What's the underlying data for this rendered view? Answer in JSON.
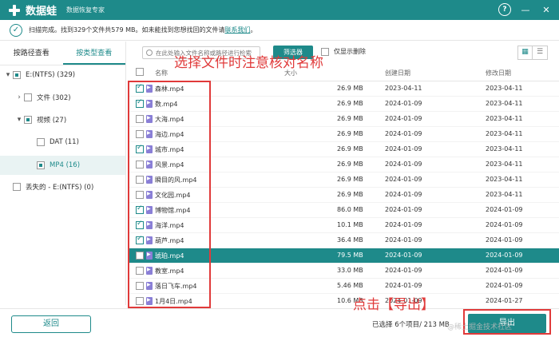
{
  "titlebar": {
    "app_name": "数据蛙",
    "subtitle": "数据恢复专家",
    "help": "?",
    "minimize": "—",
    "close": "✕"
  },
  "status": {
    "text": "扫描完成。找到329个文件共579 MB。如未能找到您想找回的文件请",
    "link": "联系我们",
    "tail": "。"
  },
  "sidebar": {
    "tabs": [
      "按路径查看",
      "按类型查看"
    ],
    "tree": [
      {
        "label": "E:(NTFS) (329)"
      },
      {
        "label": "文件 (302)"
      },
      {
        "label": "视频 (27)"
      },
      {
        "label": "DAT (11)"
      },
      {
        "label": "MP4 (16)"
      },
      {
        "label": "丢失的 - E:(NTFS) (0)"
      }
    ]
  },
  "toolbar": {
    "search_placeholder": "在此处输入文件名称或路径进行检索",
    "filter_label": "筛选器",
    "only_deleted": "仅显示删除"
  },
  "table": {
    "headers": {
      "name": "名称",
      "size": "大小",
      "created": "创建日期",
      "modified": "修改日期"
    },
    "rows": [
      {
        "name": "森林.mp4",
        "size": "26.9 MB",
        "created": "2023-04-11",
        "modified": "2023-04-11",
        "checked": true
      },
      {
        "name": "数.mp4",
        "size": "26.9 MB",
        "created": "2024-01-09",
        "modified": "2023-04-11",
        "checked": true
      },
      {
        "name": "大海.mp4",
        "size": "26.9 MB",
        "created": "2024-01-09",
        "modified": "2023-04-11",
        "checked": false
      },
      {
        "name": "海边.mp4",
        "size": "26.9 MB",
        "created": "2024-01-09",
        "modified": "2023-04-11",
        "checked": false
      },
      {
        "name": "城市.mp4",
        "size": "26.9 MB",
        "created": "2024-01-09",
        "modified": "2023-04-11",
        "checked": true
      },
      {
        "name": "风景.mp4",
        "size": "26.9 MB",
        "created": "2024-01-09",
        "modified": "2023-04-11",
        "checked": false
      },
      {
        "name": "瞬目的风.mp4",
        "size": "26.9 MB",
        "created": "2024-01-09",
        "modified": "2023-04-11",
        "checked": false
      },
      {
        "name": "文化园.mp4",
        "size": "26.9 MB",
        "created": "2024-01-09",
        "modified": "2023-04-11",
        "checked": false
      },
      {
        "name": "博物馆.mp4",
        "size": "86.0 MB",
        "created": "2024-01-09",
        "modified": "2024-01-09",
        "checked": true
      },
      {
        "name": "海洋.mp4",
        "size": "10.1 MB",
        "created": "2024-01-09",
        "modified": "2024-01-09",
        "checked": true
      },
      {
        "name": "葫芦.mp4",
        "size": "36.4 MB",
        "created": "2024-01-09",
        "modified": "2024-01-09",
        "checked": true
      },
      {
        "name": "琥珀.mp4",
        "size": "79.5 MB",
        "created": "2024-01-09",
        "modified": "2024-01-09",
        "checked": false,
        "highlight": true
      },
      {
        "name": "教室.mp4",
        "size": "33.0 MB",
        "created": "2024-01-09",
        "modified": "2024-01-09",
        "checked": false
      },
      {
        "name": "落日飞车.mp4",
        "size": "5.46 MB",
        "created": "2024-01-09",
        "modified": "2024-01-09",
        "checked": false
      },
      {
        "name": "1月4日.mp4",
        "size": "10.6 MB",
        "created": "2024-01-09",
        "modified": "2024-01-27",
        "checked": false
      }
    ]
  },
  "annotations": {
    "name_hint": "选择文件时注意核对名称",
    "export_hint": "点击【导出】"
  },
  "bottom": {
    "back_label": "返回",
    "selection_info": "已选择 6个项目/ 213 MB",
    "export_label": "导出"
  },
  "watermark": "@稀土掘金技术社区",
  "colors": {
    "accent": "#1e8a8a",
    "annotation": "#e03a3a"
  }
}
